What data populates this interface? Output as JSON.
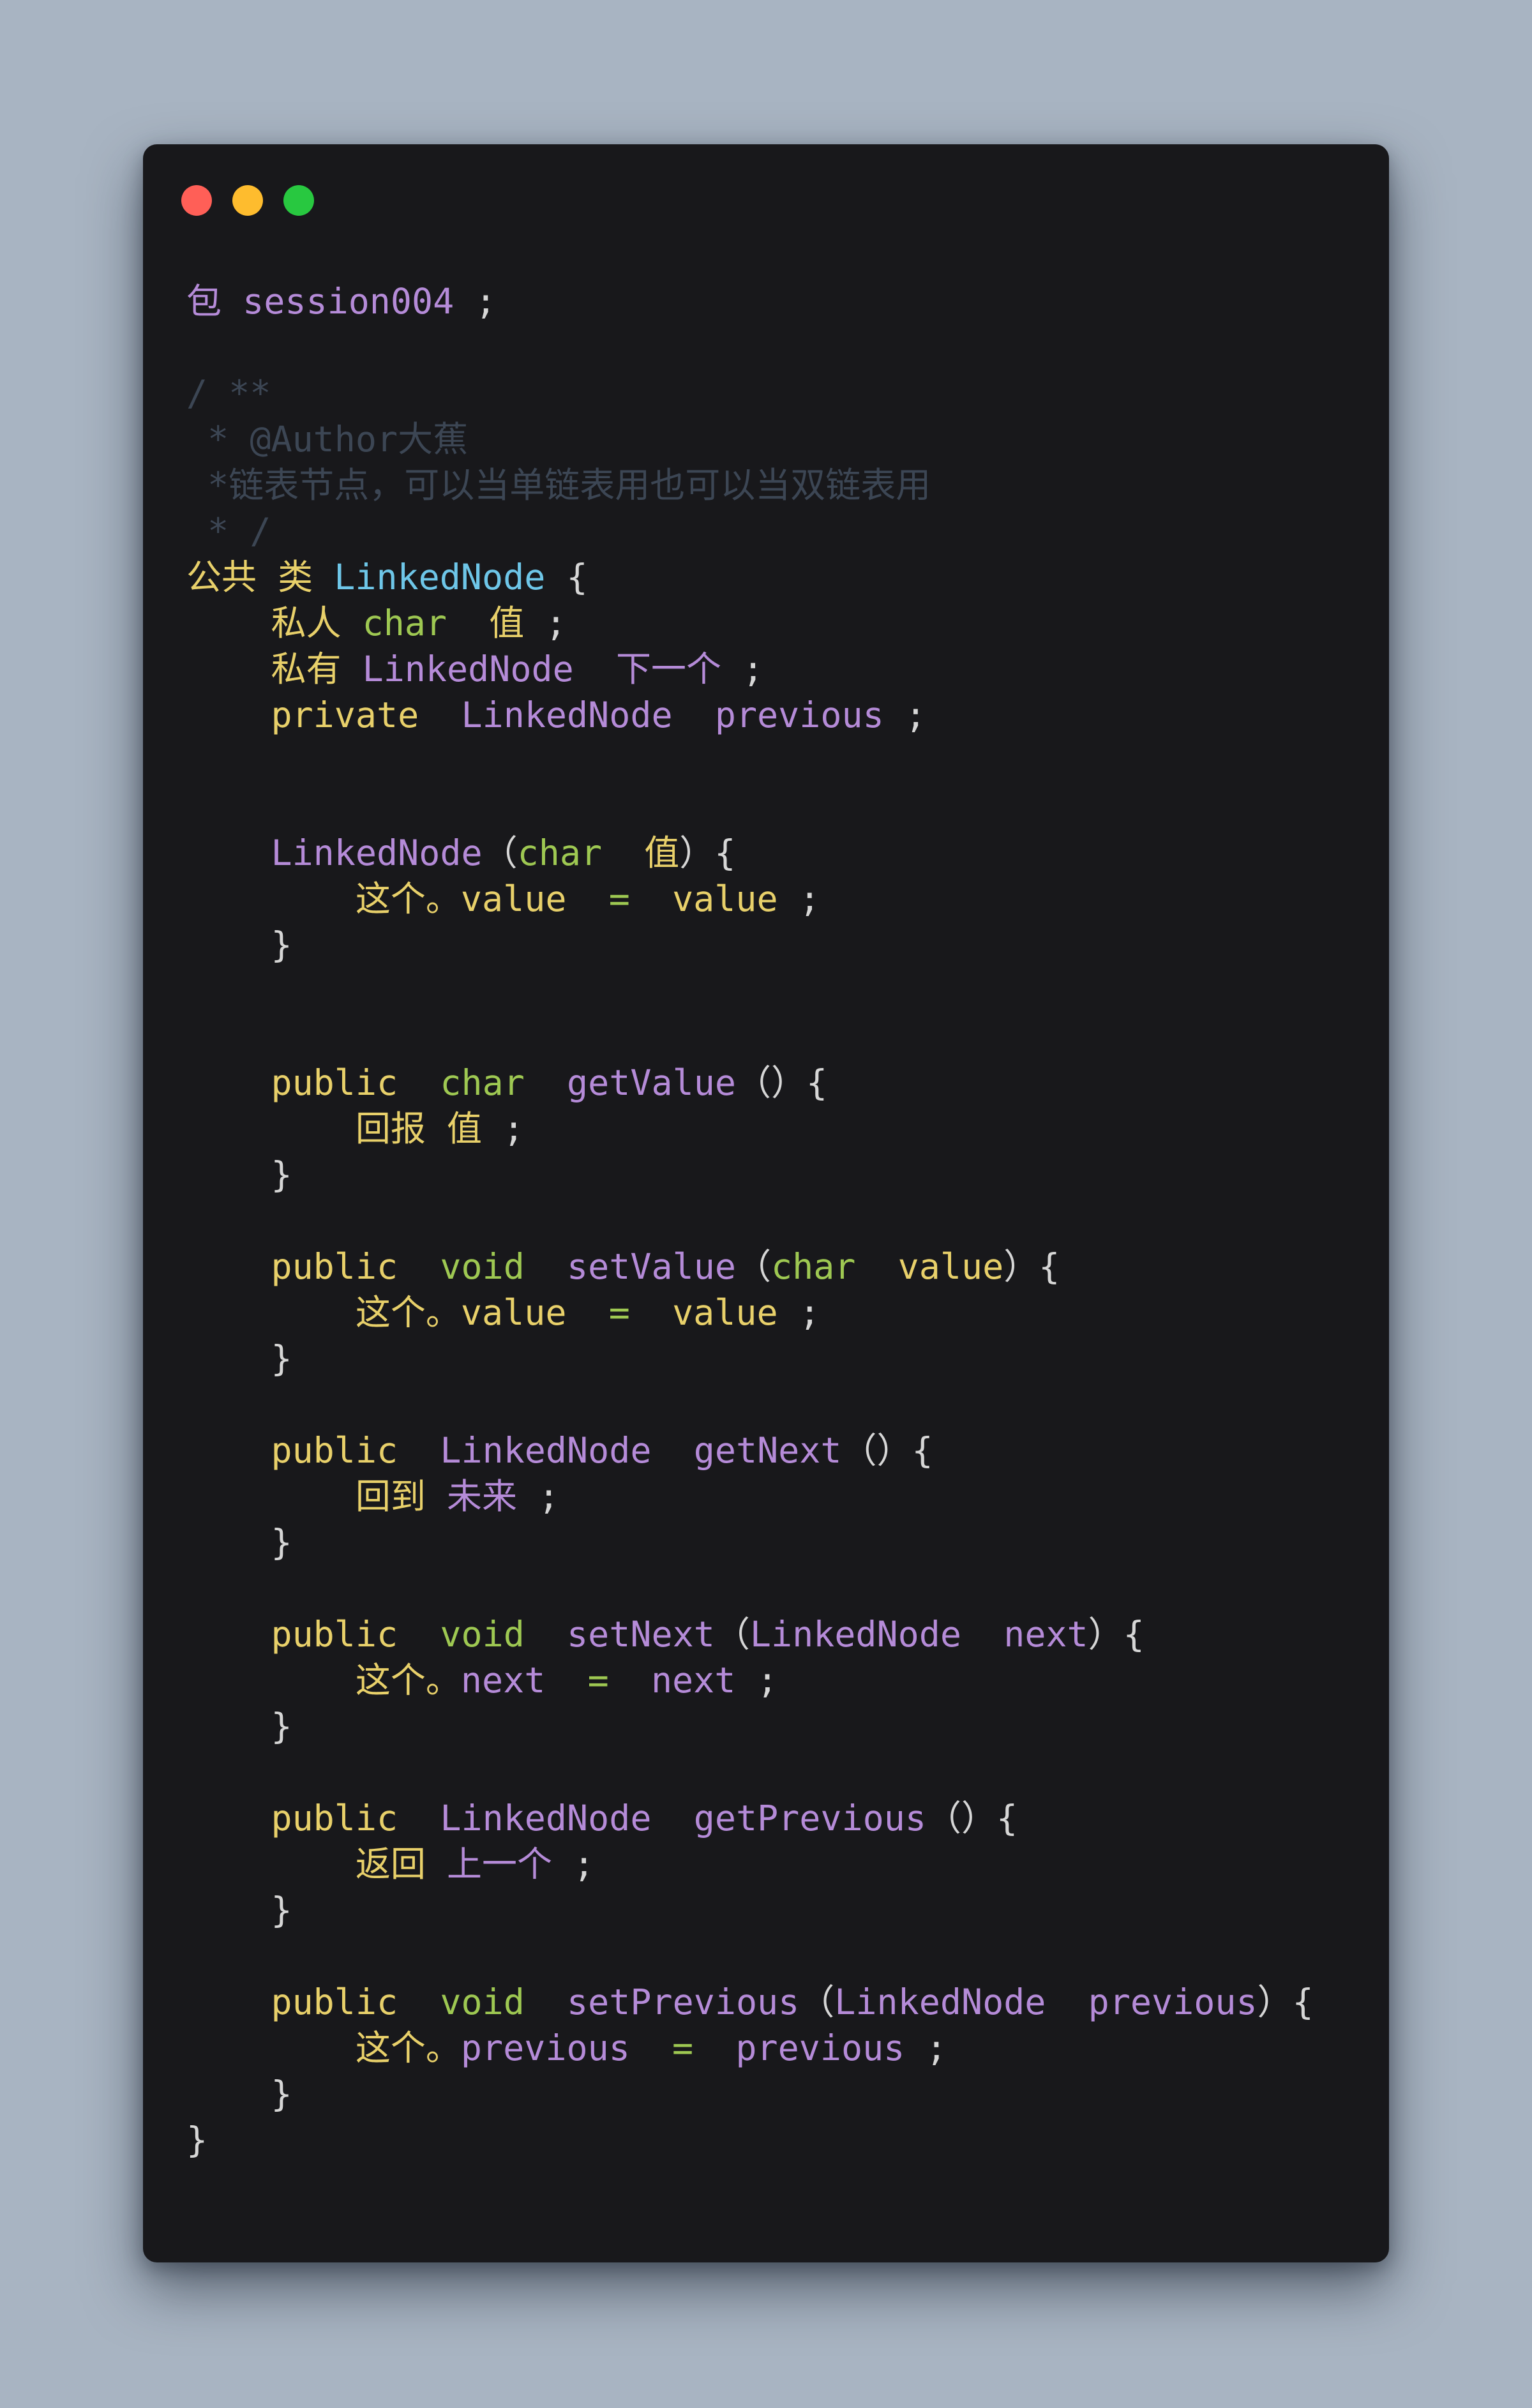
{
  "window": {
    "controls": [
      {
        "name": "close-dot",
        "color": "#ff5f57"
      },
      {
        "name": "minimize-dot",
        "color": "#febc2e"
      },
      {
        "name": "maximize-dot",
        "color": "#28c840"
      }
    ]
  },
  "colors": {
    "background": "#a8b4c2",
    "editor": "#18181b",
    "keyword": "#e8d06a",
    "type": "#9ec852",
    "identifier": "#b58bd8",
    "classname": "#6ec6e8",
    "comment": "#3c4654",
    "text": "#d6d6d6",
    "operator": "#9ec852"
  },
  "code_lines": [
    [
      {
        "t": "包 ",
        "c": "identifier"
      },
      {
        "t": "session004",
        "c": "identifier"
      },
      {
        "t": " ;",
        "c": "text"
      }
    ],
    [],
    [
      {
        "t": "/ **",
        "c": "comment"
      }
    ],
    [
      {
        "t": " * @Author大蕉",
        "c": "comment"
      }
    ],
    [
      {
        "t": " *链表节点，可以当单链表用也可以当双链表用",
        "c": "comment"
      }
    ],
    [
      {
        "t": " * /",
        "c": "comment"
      }
    ],
    [
      {
        "t": "公共 类 ",
        "c": "keyword"
      },
      {
        "t": "LinkedNode",
        "c": "classname"
      },
      {
        "t": " {",
        "c": "text"
      }
    ],
    [
      {
        "t": "    私人 ",
        "c": "keyword"
      },
      {
        "t": "char",
        "c": "type"
      },
      {
        "t": "  值",
        "c": "keyword"
      },
      {
        "t": " ;",
        "c": "text"
      }
    ],
    [
      {
        "t": "    私有 ",
        "c": "keyword"
      },
      {
        "t": "LinkedNode",
        "c": "identifier"
      },
      {
        "t": "  下一个",
        "c": "identifier"
      },
      {
        "t": " ;",
        "c": "text"
      }
    ],
    [
      {
        "t": "    private  ",
        "c": "keyword"
      },
      {
        "t": "LinkedNode",
        "c": "identifier"
      },
      {
        "t": "  previous",
        "c": "identifier"
      },
      {
        "t": " ;",
        "c": "text"
      }
    ],
    [],
    [],
    [
      {
        "t": "    LinkedNode",
        "c": "identifier"
      },
      {
        "t": "（",
        "c": "text"
      },
      {
        "t": "char",
        "c": "type"
      },
      {
        "t": "  值",
        "c": "keyword"
      },
      {
        "t": "）{",
        "c": "text"
      }
    ],
    [
      {
        "t": "        这个。",
        "c": "keyword"
      },
      {
        "t": "value",
        "c": "keyword"
      },
      {
        "t": "  =  ",
        "c": "operator"
      },
      {
        "t": "value",
        "c": "keyword"
      },
      {
        "t": " ;",
        "c": "text"
      }
    ],
    [
      {
        "t": "    }",
        "c": "text"
      }
    ],
    [],
    [],
    [
      {
        "t": "    public  ",
        "c": "keyword"
      },
      {
        "t": "char",
        "c": "type"
      },
      {
        "t": "  getValue",
        "c": "identifier"
      },
      {
        "t": "（）{",
        "c": "text"
      }
    ],
    [
      {
        "t": "        回报 值",
        "c": "keyword"
      },
      {
        "t": " ;",
        "c": "text"
      }
    ],
    [
      {
        "t": "    }",
        "c": "text"
      }
    ],
    [],
    [
      {
        "t": "    public  ",
        "c": "keyword"
      },
      {
        "t": "void",
        "c": "type"
      },
      {
        "t": "  setValue",
        "c": "identifier"
      },
      {
        "t": "（",
        "c": "text"
      },
      {
        "t": "char",
        "c": "type"
      },
      {
        "t": "  value",
        "c": "keyword"
      },
      {
        "t": "）{",
        "c": "text"
      }
    ],
    [
      {
        "t": "        这个。",
        "c": "keyword"
      },
      {
        "t": "value",
        "c": "keyword"
      },
      {
        "t": "  =  ",
        "c": "operator"
      },
      {
        "t": "value",
        "c": "keyword"
      },
      {
        "t": " ;",
        "c": "text"
      }
    ],
    [
      {
        "t": "    }",
        "c": "text"
      }
    ],
    [],
    [
      {
        "t": "    public  ",
        "c": "keyword"
      },
      {
        "t": "LinkedNode",
        "c": "identifier"
      },
      {
        "t": "  getNext",
        "c": "identifier"
      },
      {
        "t": "（）{",
        "c": "text"
      }
    ],
    [
      {
        "t": "        回到 ",
        "c": "keyword"
      },
      {
        "t": "未来",
        "c": "identifier"
      },
      {
        "t": " ;",
        "c": "text"
      }
    ],
    [
      {
        "t": "    }",
        "c": "text"
      }
    ],
    [],
    [
      {
        "t": "    public  ",
        "c": "keyword"
      },
      {
        "t": "void",
        "c": "type"
      },
      {
        "t": "  setNext",
        "c": "identifier"
      },
      {
        "t": "（",
        "c": "text"
      },
      {
        "t": "LinkedNode",
        "c": "identifier"
      },
      {
        "t": "  next",
        "c": "identifier"
      },
      {
        "t": "）{",
        "c": "text"
      }
    ],
    [
      {
        "t": "        这个。",
        "c": "keyword"
      },
      {
        "t": "next",
        "c": "identifier"
      },
      {
        "t": "  =  ",
        "c": "operator"
      },
      {
        "t": "next",
        "c": "identifier"
      },
      {
        "t": " ;",
        "c": "text"
      }
    ],
    [
      {
        "t": "    }",
        "c": "text"
      }
    ],
    [],
    [
      {
        "t": "    public  ",
        "c": "keyword"
      },
      {
        "t": "LinkedNode",
        "c": "identifier"
      },
      {
        "t": "  getPrevious",
        "c": "identifier"
      },
      {
        "t": "（）{",
        "c": "text"
      }
    ],
    [
      {
        "t": "        返回 ",
        "c": "keyword"
      },
      {
        "t": "上一个",
        "c": "identifier"
      },
      {
        "t": " ;",
        "c": "text"
      }
    ],
    [
      {
        "t": "    }",
        "c": "text"
      }
    ],
    [],
    [
      {
        "t": "    public  ",
        "c": "keyword"
      },
      {
        "t": "void",
        "c": "type"
      },
      {
        "t": "  setPrevious",
        "c": "identifier"
      },
      {
        "t": "（",
        "c": "text"
      },
      {
        "t": "LinkedNode",
        "c": "identifier"
      },
      {
        "t": "  previous",
        "c": "identifier"
      },
      {
        "t": "）{",
        "c": "text"
      }
    ],
    [
      {
        "t": "        这个。",
        "c": "keyword"
      },
      {
        "t": "previous",
        "c": "identifier"
      },
      {
        "t": "  =  ",
        "c": "operator"
      },
      {
        "t": "previous",
        "c": "identifier"
      },
      {
        "t": " ;",
        "c": "text"
      }
    ],
    [
      {
        "t": "    }",
        "c": "text"
      }
    ],
    [
      {
        "t": "}",
        "c": "text"
      }
    ]
  ]
}
